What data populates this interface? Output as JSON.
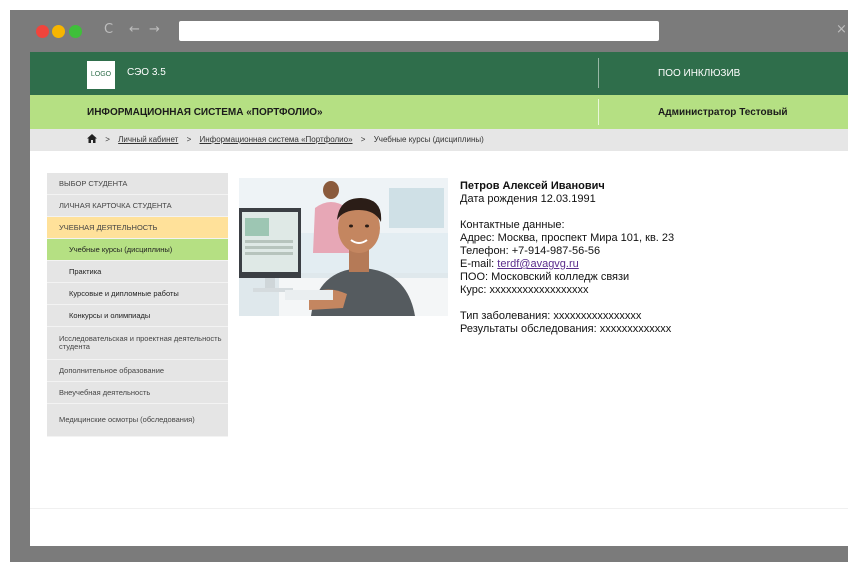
{
  "browser": {
    "reload_glyph": "C",
    "back_glyph": "←",
    "forward_glyph": "→",
    "address": "",
    "close_glyph": "×"
  },
  "header": {
    "logo_text": "LOGO",
    "app_name": "СЭО 3.5",
    "org_name": "ПОО ИНКЛЮЗИВ"
  },
  "subheader": {
    "system_title": "ИНФОРМАЦИОННАЯ СИСТЕМА «ПОРТФОЛИО»",
    "user_name": "Администратор Тестовый"
  },
  "breadcrumb": {
    "items": [
      "Личный кабинет",
      "Информационная система «Портфолио»",
      "Учебные курсы (дисциплины)"
    ]
  },
  "sidebar": {
    "items": [
      {
        "label": "ВЫБОР СТУДЕНТА"
      },
      {
        "label": "ЛИЧНАЯ КАРТОЧКА СТУДЕНТА"
      },
      {
        "label": "УЧЕБНАЯ ДЕЯТЕЛЬНОСТЬ"
      },
      {
        "label": "Учебные курсы (дисциплины)"
      },
      {
        "label": "Практика"
      },
      {
        "label": "Курсовые и дипломные работы"
      },
      {
        "label": "Конкурсы и олимпиады"
      },
      {
        "label": "Исследовательская и проектная деятельность студента"
      },
      {
        "label": "Дополнительное образование"
      },
      {
        "label": "Внеучебная деятельность"
      },
      {
        "label": "Медицинские осмотры (обследования)"
      }
    ]
  },
  "student": {
    "name": "Петров Алексей Иванович",
    "birth": "Дата рождения 12.03.1991",
    "contacts_heading": "Контактные данные:",
    "address": "Адрес: Москва, проспект Мира 101, кв. 23",
    "phone": "Телефон: +7-914-987-56-56",
    "email_label": "E-mail: ",
    "email": "terdf@avagvg.ru",
    "poo": "ПОО: Московский колледж связи",
    "course": "Курс: xxxxxxxxxxxxxxxxxx",
    "disease": "Тип заболевания: xxxxxxxxxxxxxxxx",
    "exam": "Результаты обследования: xxxxxxxxxxxxx"
  },
  "colors": {
    "header_green": "#2f6e4b",
    "light_green": "#b5e083",
    "active_yellow": "#ffe19a"
  }
}
